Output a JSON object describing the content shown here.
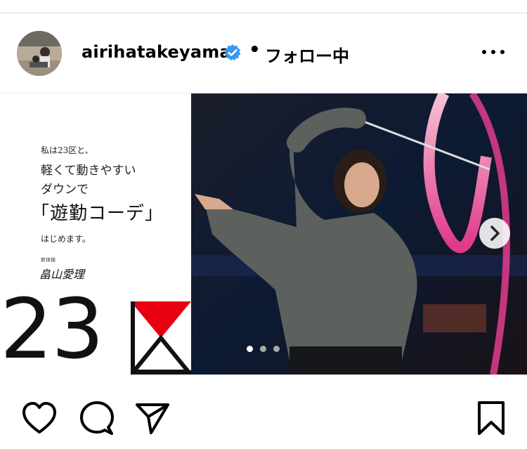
{
  "post": {
    "username": "airihatakeyama",
    "verified_icon": "verified-badge-icon",
    "separator": "•",
    "follow_status": "フォロー中",
    "more_icon": "more-options-icon"
  },
  "ad": {
    "line1": "私は23区と、",
    "line2": "軽くて動きやすい",
    "line3": "ダウンで",
    "headline": "「遊勤コーデ」",
    "line5": "はじめます。",
    "title_small": "新体操",
    "signature": "畠山愛理",
    "brand_number": "23"
  },
  "carousel": {
    "current_index": 1,
    "total": 3,
    "next_icon": "chevron-right-icon",
    "active_dot_color": "#ffffff",
    "inactive_dot_color": "#a8a8a8"
  },
  "actions": {
    "like_icon": "heart-icon",
    "comment_icon": "comment-icon",
    "share_icon": "share-icon",
    "save_icon": "bookmark-icon"
  },
  "colors": {
    "verified": "#3897f0",
    "brand_red": "#e60012"
  }
}
